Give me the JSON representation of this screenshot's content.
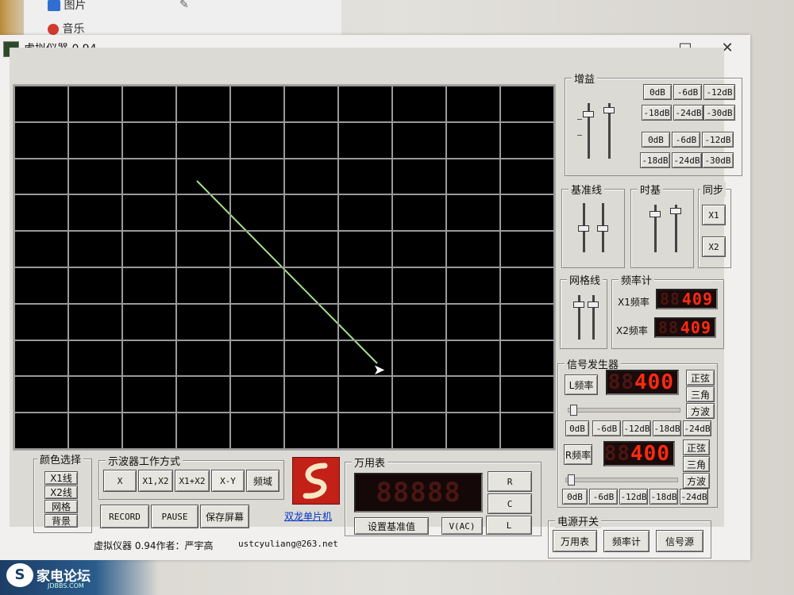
{
  "taskbar": {
    "item_pictures": "图片",
    "item_music": "音乐"
  },
  "window": {
    "title": "虚拟仪器 0.94",
    "minimize": "—",
    "maximize": "□",
    "close": "✕"
  },
  "gain": {
    "title": "增益",
    "row1": [
      "0dB",
      "-6dB",
      "-12dB"
    ],
    "row2": [
      "-18dB",
      "-24dB",
      "-30dB"
    ],
    "row3": [
      "0dB",
      "-6dB",
      "-12dB"
    ],
    "row4": [
      "-18dB",
      "-24dB",
      "-30dB"
    ]
  },
  "baseline": {
    "title": "基准线"
  },
  "timebase": {
    "title": "时基"
  },
  "sync": {
    "title": "同步",
    "x1": "X1",
    "x2": "X2"
  },
  "grid": {
    "title": "网格线"
  },
  "freqmeter": {
    "title": "频率计",
    "x1_label": "X1频率",
    "x1_value": "409",
    "x2_label": "X2频率",
    "x2_value": "409"
  },
  "siggen": {
    "title": "信号发生器",
    "l_button": "L频率",
    "l_value": "400",
    "r_button": "R频率",
    "r_value": "400",
    "wave_sine": "正弦",
    "wave_tri": "三角",
    "wave_square": "方波",
    "atten": [
      "0dB",
      "-6dB",
      "-12dB",
      "-18dB",
      "-24dB"
    ],
    "l_slider": 0.02,
    "r_slider": 0.02
  },
  "power": {
    "title": "电源开关",
    "multimeter": "万用表",
    "freq": "频率计",
    "signal": "信号源"
  },
  "color": {
    "title": "颜色选择",
    "x1": "X1线",
    "x2": "X2线",
    "grid": "网格",
    "bg": "背景"
  },
  "scope_mode": {
    "title": "示波器工作方式",
    "modes": [
      "X",
      "X1,X2",
      "X1+X2",
      "X-Y",
      "频域"
    ]
  },
  "record": {
    "record": "RECORD",
    "pause": "PAUSE",
    "save": "保存屏幕"
  },
  "logo_link": "双龙单片机",
  "multimeter": {
    "title": "万用表",
    "r": "R",
    "c": "C",
    "l": "L",
    "set_base": "设置基准值",
    "vac": "V(AC)"
  },
  "status": {
    "author": "虚拟仪器 0.94作者：严宇高",
    "email": "ustcyuliang@263.net"
  },
  "watermark": {
    "site": "家电论坛",
    "url": "JDBBS.COM"
  },
  "trace": {
    "color": "#a6e08a"
  }
}
